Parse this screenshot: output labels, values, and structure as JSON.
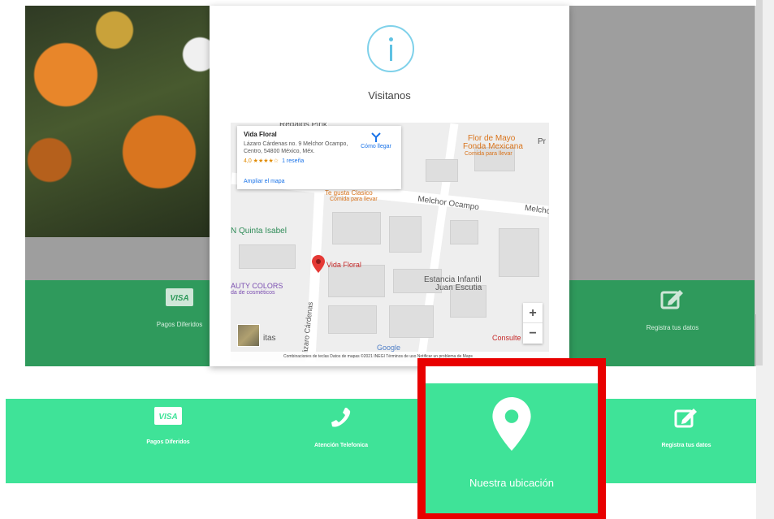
{
  "modal": {
    "title": "Visitanos",
    "info_icon": "info-icon"
  },
  "map": {
    "place_name": "Vida Floral",
    "place_address": "Lázaro Cárdenas no. 9 Melchor Ocampo, Centro, 54800 México, Méx.",
    "rating": "4,0 ★★★★☆",
    "reviews": "1 reseña",
    "directions_label": "Cómo llegar",
    "enlarge_label": "Ampliar el mapa",
    "labels": {
      "regalos": "Regalos Pink",
      "flor_de_mayo": "Flor de Mayo",
      "fonda_mexicana": "Fonda Mexicana",
      "comida_para_llevar_1": "Comida para llevar",
      "te_gusta": "Te gusta Clasico",
      "comida_para_llevar_2": "Comida para llevar",
      "melchor_ocampo": "Melchor Ocampo",
      "melchor_short": "Melcho",
      "quinta_isabel": "N Quinta Isabel",
      "vida_floral_pin": "Vida Floral",
      "estancia": "Estancia Infantil",
      "juan_escutia": "Juan Escutia",
      "beauty": "AUTY COLORS",
      "cosmeticos": "da de cosméticos",
      "lazaro_cardenas": "Lázaro Cárdenas",
      "itas": "itas",
      "consult": "Consulte",
      "pr": "Pr",
      "google": "Google"
    },
    "footer": "Combinaciones de teclas   Datos de mapas ©2021 INEGI   Términos de uso   Notificar un problema de Maps",
    "zoom_in": "+",
    "zoom_out": "−"
  },
  "frame_strip": {
    "left_label": "Pagos Diferidos",
    "right_label": "Registra tus datos"
  },
  "features": [
    {
      "label": "Pagos Diferidos",
      "icon": "visa-icon"
    },
    {
      "label": "Atención Telefonica",
      "icon": "phone-icon"
    },
    {
      "label": "Nuestra ubicación",
      "icon": "map-pin-icon"
    },
    {
      "label": "Registra tus datos",
      "icon": "edit-icon"
    }
  ],
  "colors": {
    "feature_green": "#3fe398",
    "highlight_red": "#e80000",
    "info_blue": "#5fc2e3"
  }
}
